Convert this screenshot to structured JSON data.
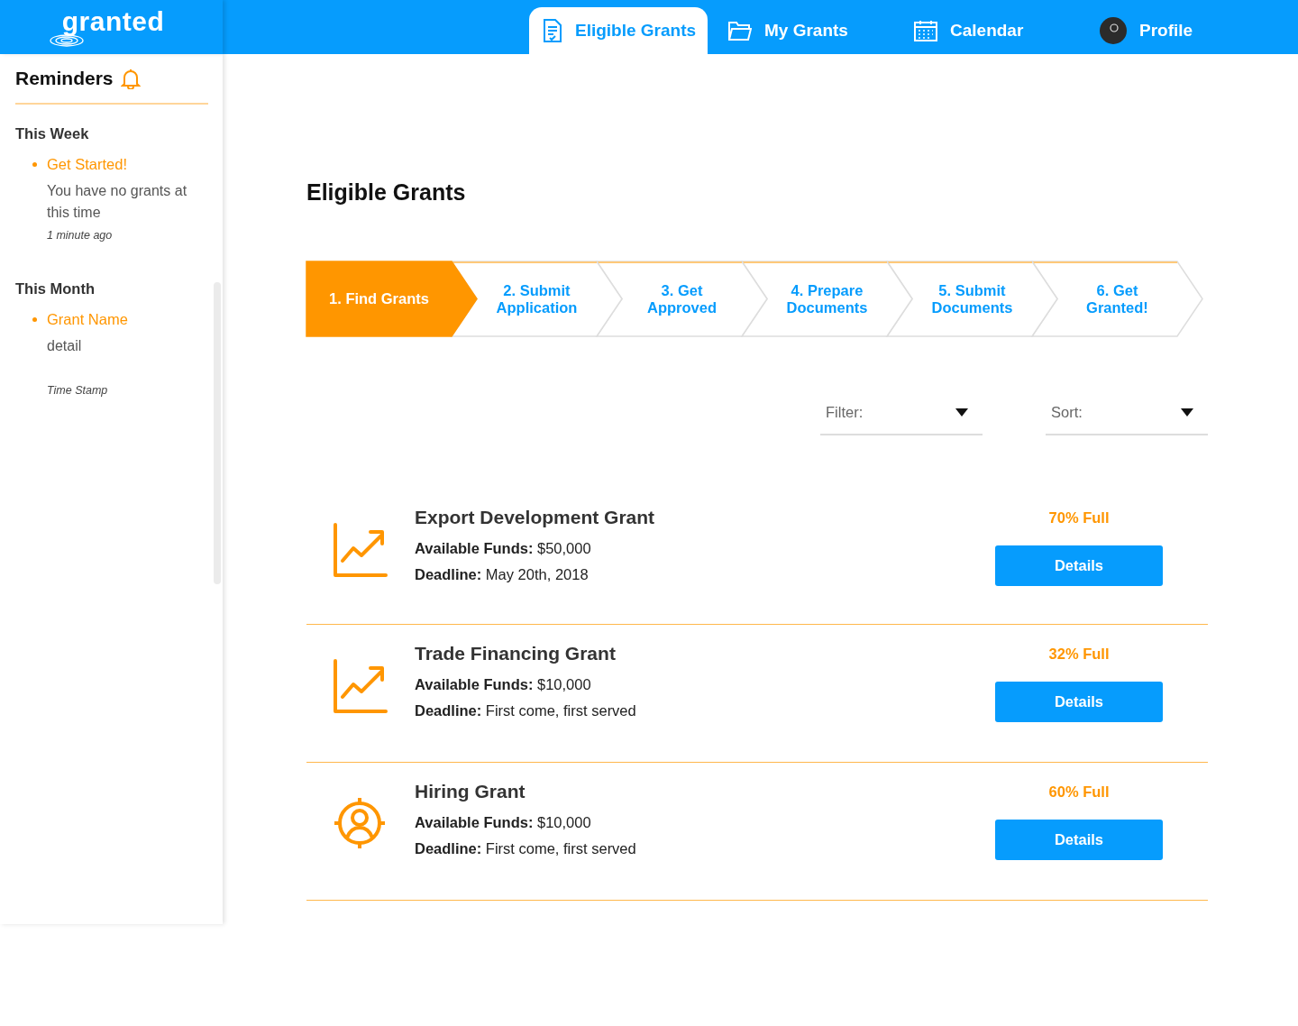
{
  "app": {
    "logo": "granted"
  },
  "nav_tabs": [
    {
      "label": "Eligible Grants",
      "kind": "document",
      "selected": true
    },
    {
      "label": "My Grants",
      "kind": "folder",
      "selected": false
    },
    {
      "label": "Calendar",
      "kind": "calendar",
      "selected": false
    },
    {
      "label": "Profile",
      "kind": "avatar",
      "selected": false
    }
  ],
  "reminders": {
    "title": "Reminders",
    "groups": [
      {
        "heading": "This Week",
        "items": [
          {
            "title": "Get Started!",
            "detail": "You have no grants at this time",
            "time": "1 minute ago"
          }
        ]
      },
      {
        "heading": "This Month",
        "items": [
          {
            "title": "Grant Name",
            "detail": "detail",
            "time": "Time Stamp"
          }
        ]
      }
    ]
  },
  "page_title": "Eligible Grants",
  "steps": [
    {
      "label": "1. Find Grants",
      "selected": true
    },
    {
      "label": "2. Submit Application",
      "selected": false
    },
    {
      "label": "3. Get Approved",
      "selected": false
    },
    {
      "label": "4. Prepare Documents",
      "selected": false
    },
    {
      "label": "5. Submit Documents",
      "selected": false
    },
    {
      "label": "6. Get Granted!",
      "selected": false
    }
  ],
  "filter": {
    "label": "Filter:"
  },
  "sort": {
    "label": "Sort:"
  },
  "grants": [
    {
      "kind": "chart",
      "name": "Export Development Grant",
      "funds": "**Available Funds:** $50,000",
      "deadline": "**Deadline:** May 20th, 2018",
      "fill": "70% Full",
      "button": "Details"
    },
    {
      "kind": "chart",
      "name": "Trade Financing Grant",
      "funds": "**Available Funds:** $10,000",
      "deadline": "**Deadline:** First come, first served",
      "fill": "32% Full",
      "button": "Details"
    },
    {
      "kind": "person",
      "name": "Hiring Grant",
      "funds": "**Available Funds:** $10,000",
      "deadline": "**Deadline:** First come, first served",
      "fill": "60% Full",
      "button": "Details"
    }
  ]
}
